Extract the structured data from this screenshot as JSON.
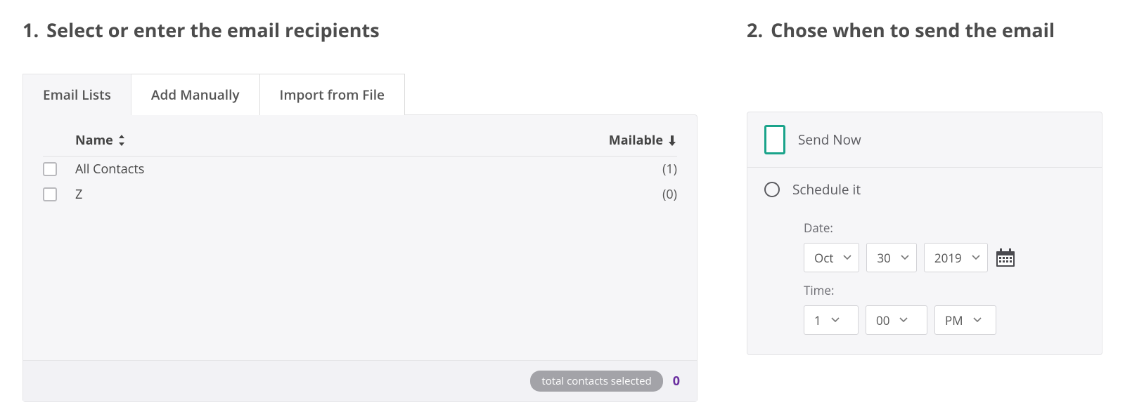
{
  "step1": {
    "number": "1.",
    "title": "Select or enter the email recipients",
    "tabs": [
      "Email Lists",
      "Add Manually",
      "Import from File"
    ],
    "headers": {
      "name": "Name",
      "mailable": "Mailable"
    },
    "rows": [
      {
        "name": "All Contacts",
        "mailable": "(1)"
      },
      {
        "name": "Z",
        "mailable": "(0)"
      }
    ],
    "footer": {
      "label": "total contacts selected",
      "count": "0"
    }
  },
  "step2": {
    "number": "2.",
    "title": "Chose when to send the email",
    "options": {
      "send_now": "Send Now",
      "schedule": "Schedule it"
    },
    "date_label": "Date:",
    "time_label": "Time:",
    "date": {
      "month": "Oct",
      "day": "30",
      "year": "2019"
    },
    "time": {
      "hour": "1",
      "minute": "00",
      "ampm": "PM"
    }
  }
}
